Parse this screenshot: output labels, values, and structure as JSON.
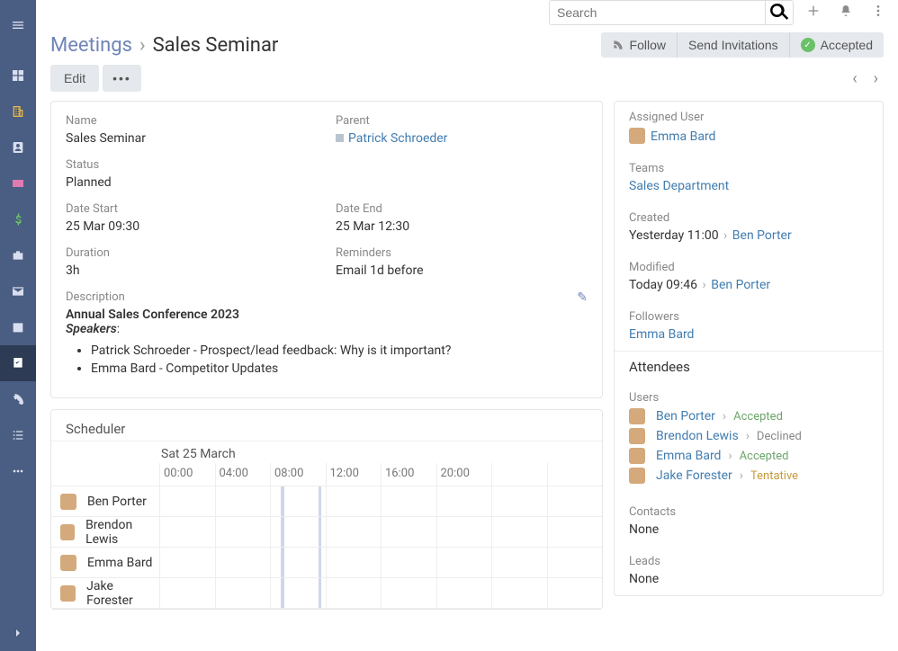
{
  "search": {
    "placeholder": "Search"
  },
  "breadcrumb": {
    "parent": "Meetings",
    "sep": "›",
    "title": "Sales Seminar"
  },
  "headerActions": {
    "follow": "Follow",
    "sendInvitations": "Send Invitations",
    "accepted": "Accepted"
  },
  "toolbar": {
    "edit": "Edit",
    "more": "•••"
  },
  "details": {
    "name_label": "Name",
    "name": "Sales Seminar",
    "parent_label": "Parent",
    "parent": "Patrick Schroeder",
    "status_label": "Status",
    "status": "Planned",
    "dateStart_label": "Date Start",
    "dateStart": "25 Mar 09:30",
    "dateEnd_label": "Date End",
    "dateEnd": "25 Mar 12:30",
    "duration_label": "Duration",
    "duration": "3h",
    "reminders_label": "Reminders",
    "reminders": "Email 1d before",
    "description_label": "Description",
    "description_title": "Annual Sales Conference 2023",
    "description_speakers_hdr": "Speakers",
    "speakers": [
      "Patrick Schroeder - Prospect/lead feedback: Why is it important?",
      "Emma Bard - Competitor Updates"
    ]
  },
  "side": {
    "assigned_label": "Assigned User",
    "assigned": "Emma Bard",
    "teams_label": "Teams",
    "teams": "Sales Department",
    "created_label": "Created",
    "created_text": "Yesterday 11:00",
    "created_by": "Ben Porter",
    "modified_label": "Modified",
    "modified_text": "Today 09:46",
    "modified_by": "Ben Porter",
    "followers_label": "Followers",
    "followers": "Emma Bard",
    "attendees_title": "Attendees",
    "users_label": "Users",
    "users": [
      {
        "name": "Ben Porter",
        "status": "Accepted",
        "cls": "st-accepted"
      },
      {
        "name": "Brendon Lewis",
        "status": "Declined",
        "cls": "st-declined"
      },
      {
        "name": "Emma Bard",
        "status": "Accepted",
        "cls": "st-accepted"
      },
      {
        "name": "Jake Forester",
        "status": "Tentative",
        "cls": "st-tentative"
      }
    ],
    "contacts_label": "Contacts",
    "contacts": "None",
    "leads_label": "Leads",
    "leads": "None",
    "sep": "›"
  },
  "scheduler": {
    "title": "Scheduler",
    "day": "Sat 25 March",
    "times": [
      "00:00",
      "04:00",
      "08:00",
      "12:00",
      "16:00",
      "20:00"
    ],
    "rows": [
      "Ben Porter",
      "Brendon Lewis",
      "Emma Bard",
      "Jake Forester"
    ]
  }
}
